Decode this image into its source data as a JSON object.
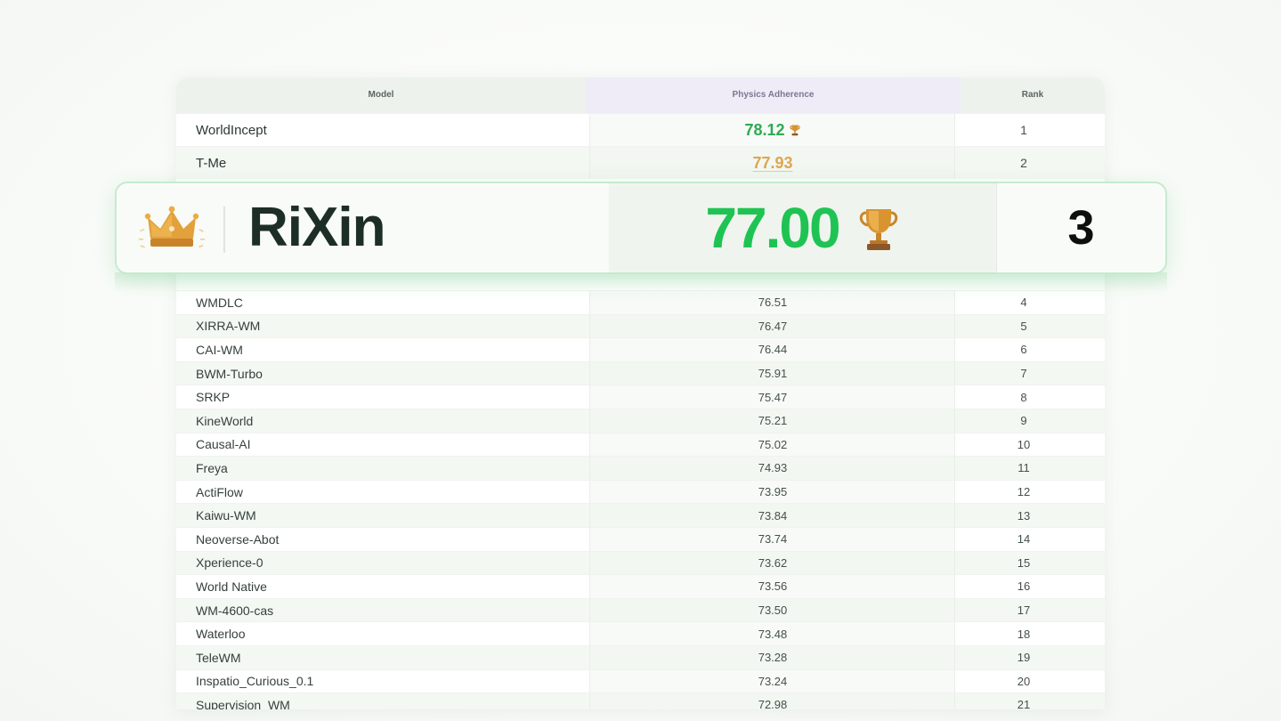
{
  "table": {
    "columns": {
      "model": "Model",
      "score": "Physics Adherence",
      "rank": "Rank"
    },
    "rows": [
      {
        "model": "WorldIncept",
        "score": "78.12",
        "rank": "1"
      },
      {
        "model": "T-Me",
        "score": "77.93",
        "rank": "2"
      },
      {
        "model": "WMDLC",
        "score": "76.51",
        "rank": "4"
      },
      {
        "model": "XIRRA-WM",
        "score": "76.47",
        "rank": "5"
      },
      {
        "model": "CAI-WM",
        "score": "76.44",
        "rank": "6"
      },
      {
        "model": "BWM-Turbo",
        "score": "75.91",
        "rank": "7"
      },
      {
        "model": "SRKP",
        "score": "75.47",
        "rank": "8"
      },
      {
        "model": "KineWorld",
        "score": "75.21",
        "rank": "9"
      },
      {
        "model": "Causal-AI",
        "score": "75.02",
        "rank": "10"
      },
      {
        "model": "Freya",
        "score": "74.93",
        "rank": "11"
      },
      {
        "model": "ActiFlow",
        "score": "73.95",
        "rank": "12"
      },
      {
        "model": "Kaiwu-WM",
        "score": "73.84",
        "rank": "13"
      },
      {
        "model": "Neoverse-Abot",
        "score": "73.74",
        "rank": "14"
      },
      {
        "model": "Xperience-0",
        "score": "73.62",
        "rank": "15"
      },
      {
        "model": "World Native",
        "score": "73.56",
        "rank": "16"
      },
      {
        "model": "WM-4600-cas",
        "score": "73.50",
        "rank": "17"
      },
      {
        "model": "Waterloo",
        "score": "73.48",
        "rank": "18"
      },
      {
        "model": "TeleWM",
        "score": "73.28",
        "rank": "19"
      },
      {
        "model": "Inspatio_Curious_0.1",
        "score": "73.24",
        "rank": "20"
      },
      {
        "model": "Supervision_WM",
        "score": "72.98",
        "rank": "21"
      }
    ]
  },
  "featured": {
    "model": "RiXin",
    "score": "77.00",
    "rank": "3",
    "crown_icon": "crown-icon",
    "trophy_icon": "trophy-icon"
  },
  "colors": {
    "featured_score": "#1fc353",
    "first_score": "#2eaa55",
    "second_score": "#e0a54e",
    "header_bg": "#edf2ec",
    "score_header_bg": "#efecf7"
  }
}
